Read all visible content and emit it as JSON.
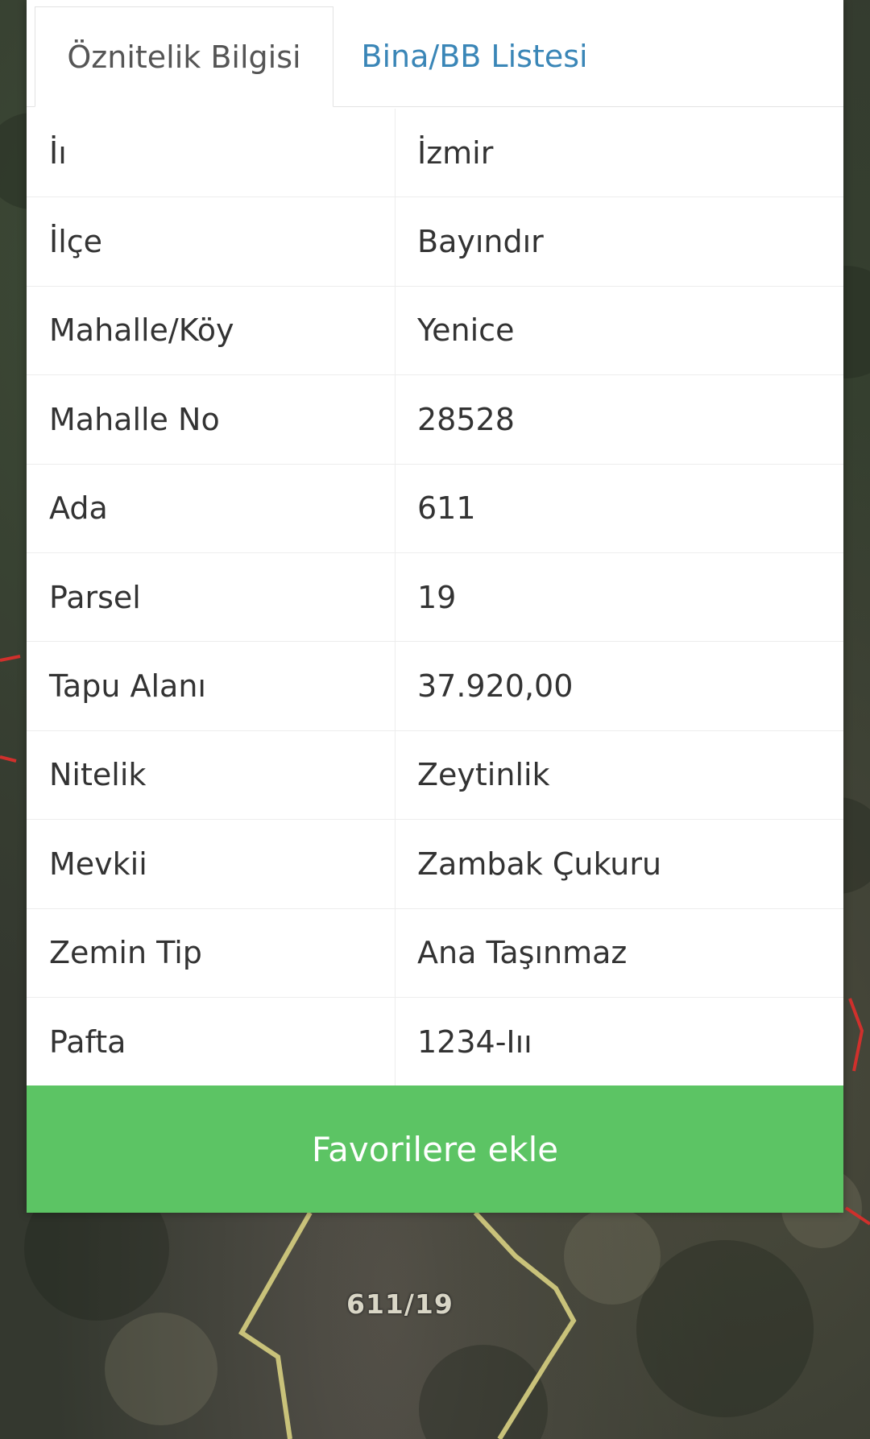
{
  "tabs": {
    "attribute_info": "Öznitelik Bilgisi",
    "building_list": "Bina/BB Listesi"
  },
  "attributes": [
    {
      "label": "İı",
      "value": "İzmir"
    },
    {
      "label": "İlçe",
      "value": "Bayındır"
    },
    {
      "label": "Mahalle/Köy",
      "value": "Yenice"
    },
    {
      "label": "Mahalle No",
      "value": "28528"
    },
    {
      "label": "Ada",
      "value": "611"
    },
    {
      "label": "Parsel",
      "value": "19"
    },
    {
      "label": "Tapu Alanı",
      "value": "37.920,00"
    },
    {
      "label": "Nitelik",
      "value": "Zeytinlik"
    },
    {
      "label": "Mevkii",
      "value": "Zambak Çukuru"
    },
    {
      "label": "Zemin Tip",
      "value": "Ana Taşınmaz"
    },
    {
      "label": "Pafta",
      "value": "1234-Iıı"
    }
  ],
  "favorite_button": "Favorilere ekle",
  "map": {
    "parcel_label": "611/19"
  },
  "colors": {
    "active_tab_text": "#555555",
    "inactive_tab_text": "#3a86b7",
    "button_bg": "#5cc464",
    "parcel_outline": "#c9c27a",
    "neighbor_outline": "#d0302c"
  }
}
